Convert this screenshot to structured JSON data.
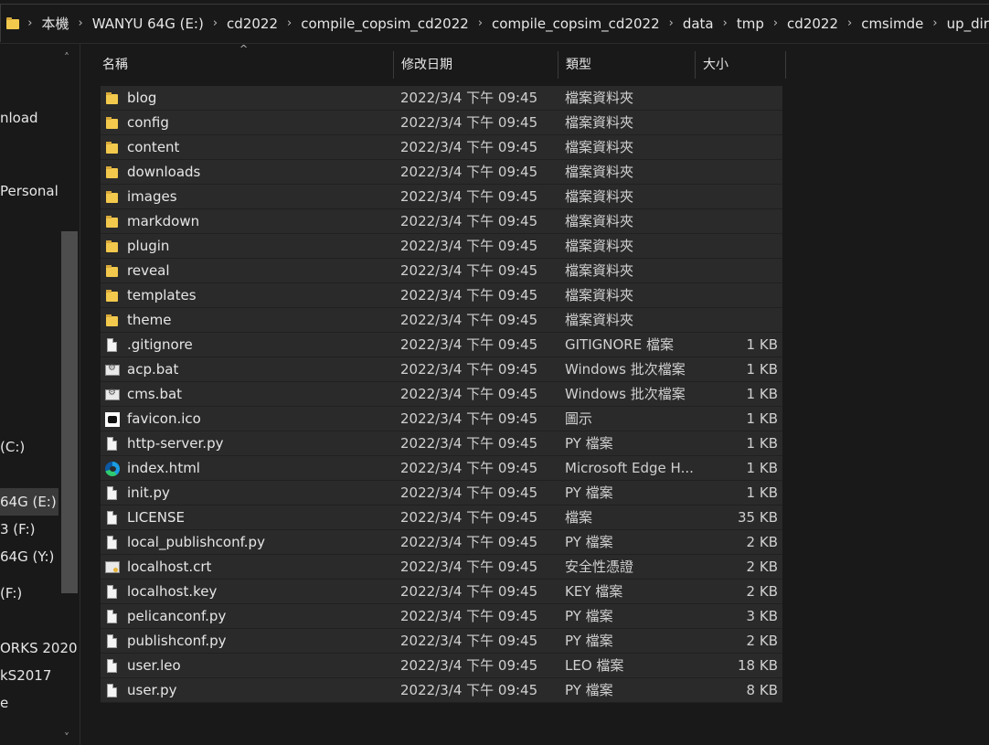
{
  "address_bar": {
    "crumbs": [
      "本機",
      "WANYU 64G (E:)",
      "cd2022",
      "compile_copsim_cd2022",
      "compile_copsim_cd2022",
      "data",
      "tmp",
      "cd2022",
      "cmsimde",
      "up_dir"
    ],
    "separator": "›"
  },
  "nav": {
    "items": [
      {
        "label": "nload"
      },
      {
        "label": "Personal"
      },
      {
        "label": "(C:)"
      },
      {
        "label": "64G (E:)",
        "selected": true
      },
      {
        "label": "3 (F:)"
      },
      {
        "label": "64G (Y:)"
      },
      {
        "label": "(F:)"
      },
      {
        "label": "ORKS 2020"
      },
      {
        "label": "kS2017"
      },
      {
        "label": "e"
      }
    ],
    "scroll_up": "˄",
    "scroll_down": "˅"
  },
  "header": {
    "name": "名稱",
    "date": "修改日期",
    "type": "類型",
    "size": "大小",
    "sort_indicator": "^"
  },
  "files": [
    {
      "name": "blog",
      "date": "2022/3/4 下午 09:45",
      "type": "檔案資料夾",
      "size": "",
      "icon": "folder-icon"
    },
    {
      "name": "config",
      "date": "2022/3/4 下午 09:45",
      "type": "檔案資料夾",
      "size": "",
      "icon": "folder-icon"
    },
    {
      "name": "content",
      "date": "2022/3/4 下午 09:45",
      "type": "檔案資料夾",
      "size": "",
      "icon": "folder-icon"
    },
    {
      "name": "downloads",
      "date": "2022/3/4 下午 09:45",
      "type": "檔案資料夾",
      "size": "",
      "icon": "folder-icon"
    },
    {
      "name": "images",
      "date": "2022/3/4 下午 09:45",
      "type": "檔案資料夾",
      "size": "",
      "icon": "folder-icon"
    },
    {
      "name": "markdown",
      "date": "2022/3/4 下午 09:45",
      "type": "檔案資料夾",
      "size": "",
      "icon": "folder-icon"
    },
    {
      "name": "plugin",
      "date": "2022/3/4 下午 09:45",
      "type": "檔案資料夾",
      "size": "",
      "icon": "folder-icon"
    },
    {
      "name": "reveal",
      "date": "2022/3/4 下午 09:45",
      "type": "檔案資料夾",
      "size": "",
      "icon": "folder-icon"
    },
    {
      "name": "templates",
      "date": "2022/3/4 下午 09:45",
      "type": "檔案資料夾",
      "size": "",
      "icon": "folder-icon"
    },
    {
      "name": "theme",
      "date": "2022/3/4 下午 09:45",
      "type": "檔案資料夾",
      "size": "",
      "icon": "folder-icon"
    },
    {
      "name": ".gitignore",
      "date": "2022/3/4 下午 09:45",
      "type": "GITIGNORE 檔案",
      "size": "1 KB",
      "icon": "file-icon"
    },
    {
      "name": "acp.bat",
      "date": "2022/3/4 下午 09:45",
      "type": "Windows 批次檔案",
      "size": "1 KB",
      "icon": "batch-file-icon"
    },
    {
      "name": "cms.bat",
      "date": "2022/3/4 下午 09:45",
      "type": "Windows 批次檔案",
      "size": "1 KB",
      "icon": "batch-file-icon"
    },
    {
      "name": "favicon.ico",
      "date": "2022/3/4 下午 09:45",
      "type": "圖示",
      "size": "1 KB",
      "icon": "image-icon"
    },
    {
      "name": "http-server.py",
      "date": "2022/3/4 下午 09:45",
      "type": "PY 檔案",
      "size": "1 KB",
      "icon": "file-icon"
    },
    {
      "name": "index.html",
      "date": "2022/3/4 下午 09:45",
      "type": "Microsoft Edge H...",
      "size": "1 KB",
      "icon": "edge-icon"
    },
    {
      "name": "init.py",
      "date": "2022/3/4 下午 09:45",
      "type": "PY 檔案",
      "size": "1 KB",
      "icon": "file-icon"
    },
    {
      "name": "LICENSE",
      "date": "2022/3/4 下午 09:45",
      "type": "檔案",
      "size": "35 KB",
      "icon": "file-icon"
    },
    {
      "name": "local_publishconf.py",
      "date": "2022/3/4 下午 09:45",
      "type": "PY 檔案",
      "size": "2 KB",
      "icon": "file-icon"
    },
    {
      "name": "localhost.crt",
      "date": "2022/3/4 下午 09:45",
      "type": "安全性憑證",
      "size": "2 KB",
      "icon": "certificate-icon"
    },
    {
      "name": "localhost.key",
      "date": "2022/3/4 下午 09:45",
      "type": "KEY 檔案",
      "size": "2 KB",
      "icon": "file-icon"
    },
    {
      "name": "pelicanconf.py",
      "date": "2022/3/4 下午 09:45",
      "type": "PY 檔案",
      "size": "3 KB",
      "icon": "file-icon"
    },
    {
      "name": "publishconf.py",
      "date": "2022/3/4 下午 09:45",
      "type": "PY 檔案",
      "size": "2 KB",
      "icon": "file-icon"
    },
    {
      "name": "user.leo",
      "date": "2022/3/4 下午 09:45",
      "type": "LEO 檔案",
      "size": "18 KB",
      "icon": "file-icon"
    },
    {
      "name": "user.py",
      "date": "2022/3/4 下午 09:45",
      "type": "PY 檔案",
      "size": "8 KB",
      "icon": "file-icon"
    }
  ],
  "colors": {
    "background": "#191919",
    "row": "#2a2a2a",
    "folder": "#f3c94d",
    "text": "#e6e6e6"
  }
}
